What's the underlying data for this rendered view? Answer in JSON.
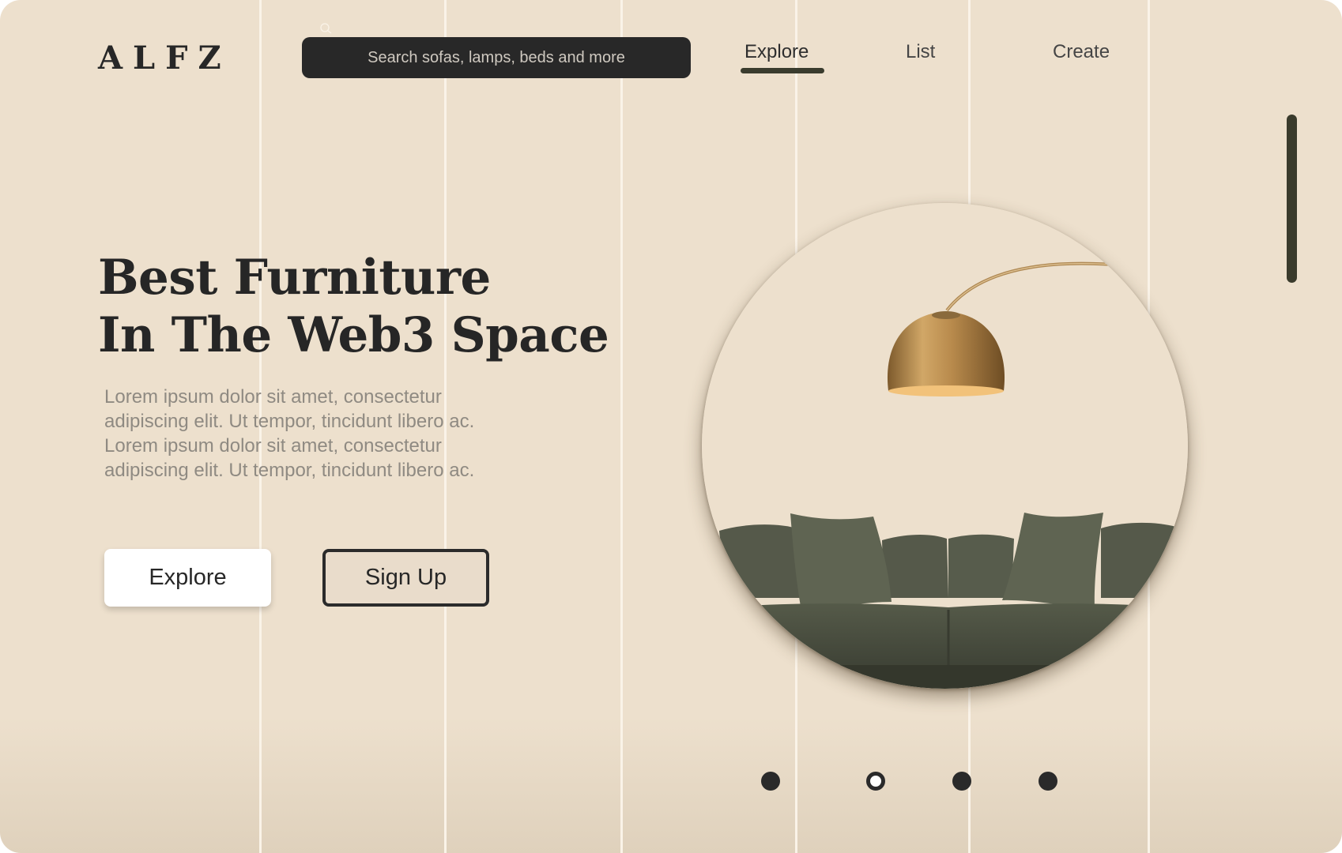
{
  "header": {
    "logo": "ALFZ",
    "search": {
      "placeholder": "Search sofas, lamps, beds and more",
      "icon": "search-icon"
    },
    "nav": {
      "items": [
        {
          "label": "Explore",
          "active": true
        },
        {
          "label": "List",
          "active": false
        },
        {
          "label": "Create",
          "active": false
        }
      ]
    }
  },
  "hero": {
    "headline_line1": "Best Furniture",
    "headline_line2": "In The Web3 Space",
    "description": "Lorem ipsum dolor sit amet, consectetur adipiscing elit. Ut tempor, tincidunt libero ac. Lorem ipsum dolor sit amet, consectetur adipiscing elit. Ut tempor, tincidunt libero ac.",
    "explore_label": "Explore",
    "signup_label": "Sign Up",
    "image_subject": "arc floor lamp and green sofa"
  },
  "carousel": {
    "count": 4,
    "active_index": 1
  },
  "colors": {
    "background": "#ede0cd",
    "dark": "#282828",
    "accent": "#3a3c2e",
    "sofa": "#4f5445",
    "lamp": "#b8894a"
  }
}
